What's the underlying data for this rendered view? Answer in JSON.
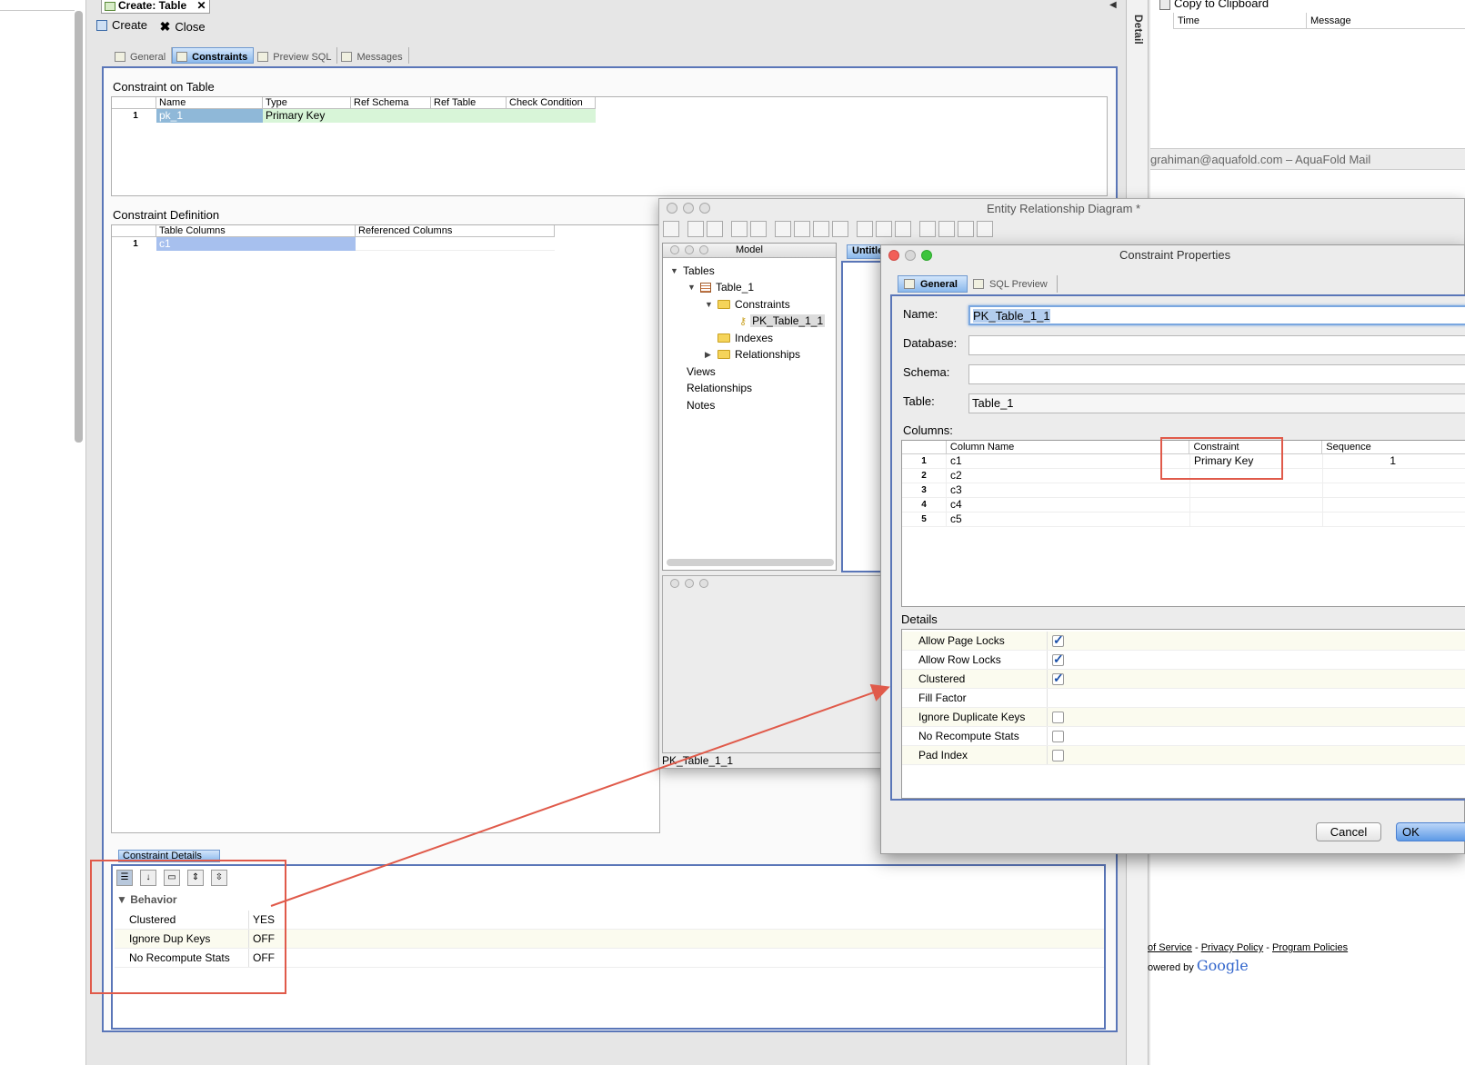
{
  "editor": {
    "tab_title": "Create: Table",
    "tab_close": "✕",
    "tab_nav": "◀ ▶ ▤",
    "toolbar": {
      "create_label": "Create",
      "close_label": "Close"
    },
    "subtabs": [
      {
        "label": "General"
      },
      {
        "label": "Constraints"
      },
      {
        "label": "Preview SQL"
      },
      {
        "label": "Messages"
      }
    ],
    "active_subtab": "Constraints",
    "constraint_on_table": {
      "title": "Constraint on Table",
      "columns": [
        "Name",
        "Type",
        "Ref Schema",
        "Ref Table",
        "Check Condition"
      ],
      "rows": [
        {
          "num": "1",
          "name": "pk_1",
          "type": "Primary Key"
        }
      ]
    },
    "constraint_definition": {
      "title": "Constraint Definition",
      "columns": [
        "Table Columns",
        "Referenced Columns"
      ],
      "rows": [
        {
          "num": "1",
          "table_column": "c1",
          "referenced": ""
        }
      ]
    },
    "constraint_details": {
      "tab_label": "Constraint Details",
      "group": "Behavior",
      "rows": [
        {
          "name": "Clustered",
          "value": "YES"
        },
        {
          "name": "Ignore Dup Keys",
          "value": "OFF"
        },
        {
          "name": "No Recompute Stats",
          "value": "OFF"
        }
      ]
    }
  },
  "detail_strip": {
    "label": "Detail"
  },
  "right_panel": {
    "copy_label": "Copy to Clipboard",
    "columns": [
      "Time",
      "Message"
    ],
    "mail_title": "grahiman@aquafold.com – AquaFold Mail",
    "footer_links": [
      "of Service",
      "Privacy Policy",
      "Program Policies"
    ],
    "footer_sep": "-",
    "powered_by": "owered by",
    "google": "Google"
  },
  "erd": {
    "title": "Entity Relationship Diagram *",
    "model_label": "Model",
    "tree": {
      "tables": "Tables",
      "table_1": "Table_1",
      "constraints": "Constraints",
      "pk": "PK_Table_1_1",
      "indexes": "Indexes",
      "relationships": "Relationships",
      "views": "Views",
      "relationships_root": "Relationships",
      "notes": "Notes"
    },
    "canvas_tab": "Untitled",
    "status": "PK_Table_1_1"
  },
  "constraint_properties": {
    "title": "Constraint Properties",
    "tabs": [
      {
        "label": "General"
      },
      {
        "label": "SQL Preview"
      }
    ],
    "fields": {
      "name_label": "Name:",
      "name_value": "PK_Table_1_1",
      "database_label": "Database:",
      "database_value": "",
      "schema_label": "Schema:",
      "schema_value": "",
      "table_label": "Table:",
      "table_value": "Table_1"
    },
    "columns_label": "Columns:",
    "columns_grid": {
      "headers": [
        "Column Name",
        "Constraint",
        "Sequence"
      ],
      "rows": [
        {
          "num": "1",
          "name": "c1",
          "constraint": "Primary Key",
          "sequence": "1"
        },
        {
          "num": "2",
          "name": "c2",
          "constraint": "",
          "sequence": ""
        },
        {
          "num": "3",
          "name": "c3",
          "constraint": "",
          "sequence": ""
        },
        {
          "num": "4",
          "name": "c4",
          "constraint": "",
          "sequence": ""
        },
        {
          "num": "5",
          "name": "c5",
          "constraint": "",
          "sequence": ""
        }
      ]
    },
    "details_label": "Details",
    "details": [
      {
        "name": "Allow Page Locks",
        "checked": true
      },
      {
        "name": "Allow Row Locks",
        "checked": true
      },
      {
        "name": "Clustered",
        "checked": true
      },
      {
        "name": "Fill Factor",
        "checked": null
      },
      {
        "name": "Ignore Duplicate Keys",
        "checked": false
      },
      {
        "name": "No Recompute Stats",
        "checked": false
      },
      {
        "name": "Pad Index",
        "checked": false
      }
    ],
    "cancel_label": "Cancel",
    "ok_label": "OK"
  },
  "colors": {
    "accent_border": "#5a76b8",
    "annotation_red": "#e05a4a",
    "selection_blue": "#b3cdee",
    "row_highlight_green": "#d8f5d8"
  }
}
